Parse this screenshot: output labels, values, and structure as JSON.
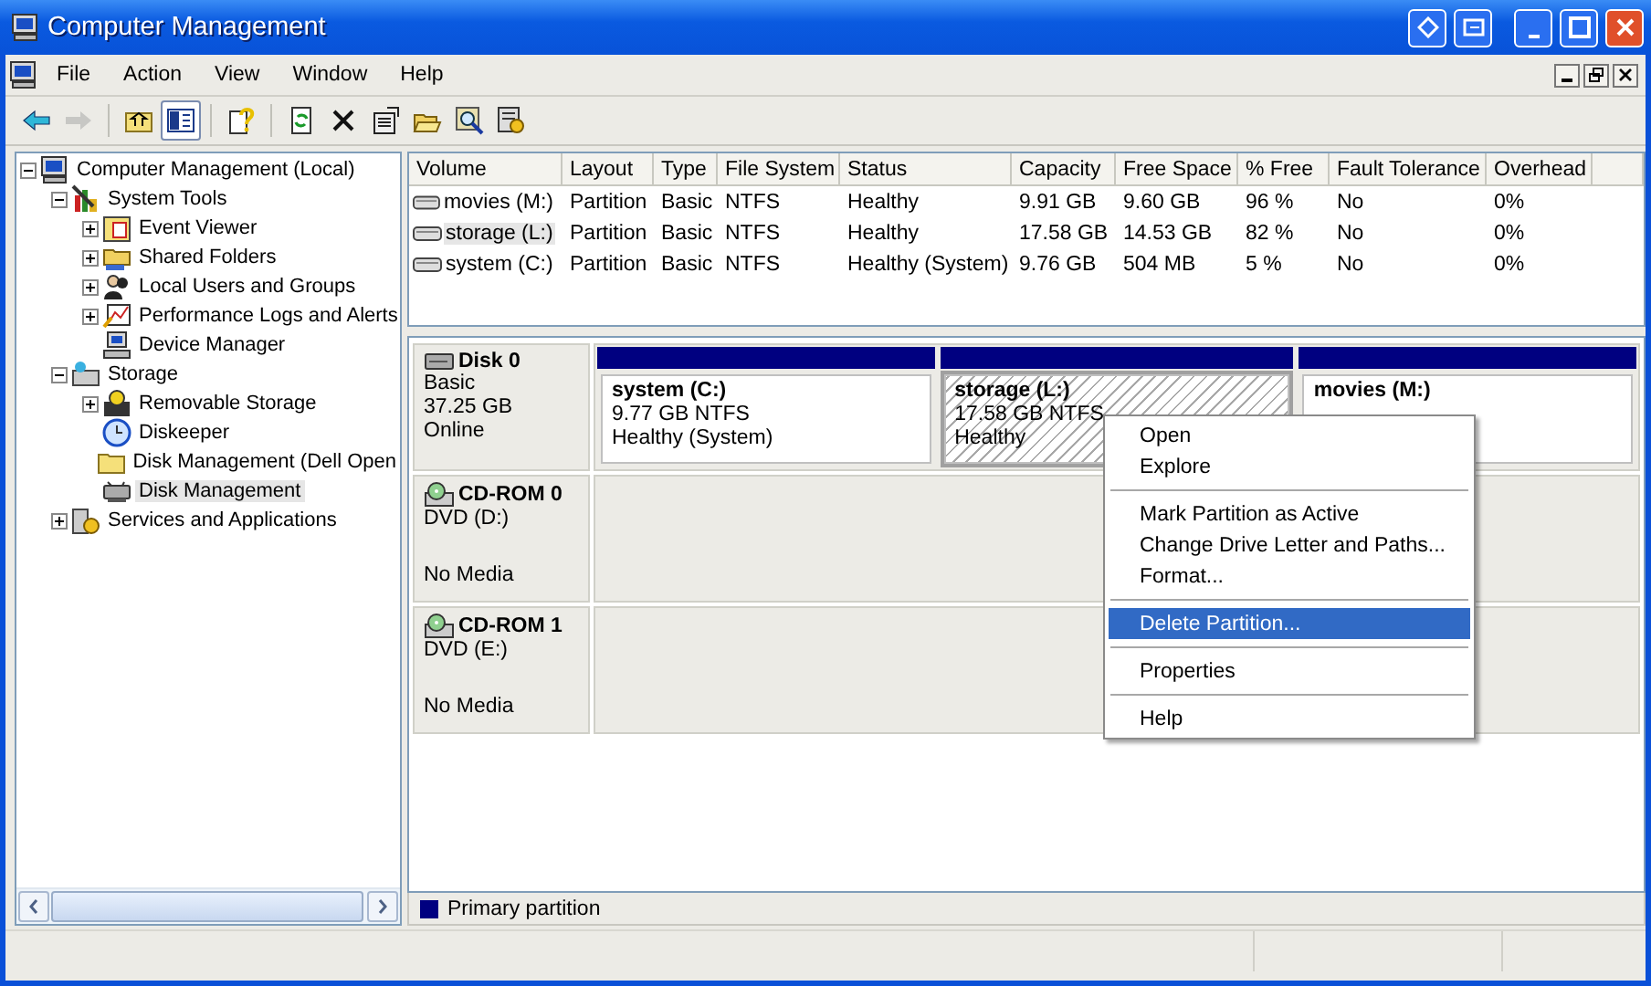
{
  "window": {
    "title": "Computer Management"
  },
  "menu": [
    "File",
    "Action",
    "View",
    "Window",
    "Help"
  ],
  "toolbar": [
    {
      "kind": "back",
      "disabled": false,
      "pressed": false
    },
    {
      "kind": "forward",
      "disabled": true,
      "pressed": false
    },
    {
      "kind": "separator"
    },
    {
      "kind": "up",
      "disabled": false,
      "pressed": false
    },
    {
      "kind": "tree",
      "disabled": false,
      "pressed": true
    },
    {
      "kind": "separator"
    },
    {
      "kind": "help",
      "disabled": false,
      "pressed": false
    },
    {
      "kind": "separator"
    },
    {
      "kind": "refresh",
      "disabled": false,
      "pressed": false
    },
    {
      "kind": "delete",
      "disabled": false,
      "pressed": false
    },
    {
      "kind": "properties",
      "disabled": false,
      "pressed": false
    },
    {
      "kind": "open",
      "disabled": false,
      "pressed": false
    },
    {
      "kind": "search",
      "disabled": false,
      "pressed": false
    },
    {
      "kind": "settings",
      "disabled": false,
      "pressed": false
    }
  ],
  "tree": {
    "items": [
      {
        "label": "Computer Management (Local)",
        "kind": "node",
        "expanded": true,
        "selected": false,
        "children": [
          {
            "label": "System Tools",
            "kind": "node",
            "expanded": true,
            "selected": false,
            "children": [
              {
                "label": "Event Viewer",
                "kind": "node",
                "expanded": false,
                "selected": false
              },
              {
                "label": "Shared Folders",
                "kind": "node",
                "expanded": false,
                "selected": false
              },
              {
                "label": "Local Users and Groups",
                "kind": "node",
                "expanded": false,
                "selected": false
              },
              {
                "label": "Performance Logs and Alerts",
                "kind": "node",
                "expanded": false,
                "selected": false
              },
              {
                "label": "Device Manager",
                "kind": "leaf",
                "selected": false
              }
            ]
          },
          {
            "label": "Storage",
            "kind": "node",
            "expanded": true,
            "selected": false,
            "children": [
              {
                "label": "Removable Storage",
                "kind": "node",
                "expanded": false,
                "selected": false
              },
              {
                "label": "Diskeeper",
                "kind": "leaf",
                "selected": false
              },
              {
                "label": "Disk Management (Dell Open",
                "kind": "leaf",
                "selected": false
              },
              {
                "label": "Disk Management",
                "kind": "leaf",
                "selected": true
              }
            ]
          },
          {
            "label": "Services and Applications",
            "kind": "node",
            "expanded": false,
            "selected": false
          }
        ]
      }
    ]
  },
  "volumes": {
    "columns": [
      "Volume",
      "Layout",
      "Type",
      "File System",
      "Status",
      "Capacity",
      "Free Space",
      "% Free",
      "Fault Tolerance",
      "Overhead"
    ],
    "rows": [
      {
        "selected": false,
        "cells": [
          "movies (M:)",
          "Partition",
          "Basic",
          "NTFS",
          "Healthy",
          "9.91 GB",
          "9.60 GB",
          "96 %",
          "No",
          "0%"
        ]
      },
      {
        "selected": true,
        "cells": [
          "storage (L:)",
          "Partition",
          "Basic",
          "NTFS",
          "Healthy",
          "17.58 GB",
          "14.53 GB",
          "82 %",
          "No",
          "0%"
        ]
      },
      {
        "selected": false,
        "cells": [
          "system (C:)",
          "Partition",
          "Basic",
          "NTFS",
          "Healthy (System)",
          "9.76 GB",
          "504 MB",
          "5 %",
          "No",
          "0%"
        ]
      }
    ]
  },
  "disks": [
    {
      "kind": "disk",
      "name": "Disk 0",
      "type": "Basic",
      "size": "37.25 GB",
      "status": "Online",
      "partitions": [
        {
          "name": "system  (C:)",
          "size": "9.77 GB NTFS",
          "status": "Healthy (System)",
          "selected": false
        },
        {
          "name": "storage  (L:)",
          "size": "17.58 GB NTFS",
          "status": "Healthy",
          "selected": true
        },
        {
          "name": "movies  (M:)",
          "selected": false
        }
      ]
    },
    {
      "kind": "cdrom",
      "name": "CD-ROM 0",
      "type": "DVD (D:)",
      "status": "No Media"
    },
    {
      "kind": "cdrom",
      "name": "CD-ROM 1",
      "type": "DVD (E:)",
      "status": "No Media"
    }
  ],
  "legend": [
    {
      "label": "Primary partition",
      "color": "#000080"
    }
  ],
  "context_menu": [
    {
      "kind": "item",
      "label": "Open",
      "selected": false
    },
    {
      "kind": "item",
      "label": "Explore",
      "selected": false
    },
    {
      "kind": "separator"
    },
    {
      "kind": "item",
      "label": "Mark Partition as Active",
      "selected": false
    },
    {
      "kind": "item",
      "label": "Change Drive Letter and Paths...",
      "selected": false
    },
    {
      "kind": "item",
      "label": "Format...",
      "selected": false
    },
    {
      "kind": "separator"
    },
    {
      "kind": "item",
      "label": "Delete Partition...",
      "selected": true
    },
    {
      "kind": "separator"
    },
    {
      "kind": "item",
      "label": "Properties",
      "selected": false
    },
    {
      "kind": "separator"
    },
    {
      "kind": "item",
      "label": "Help",
      "selected": false
    }
  ]
}
